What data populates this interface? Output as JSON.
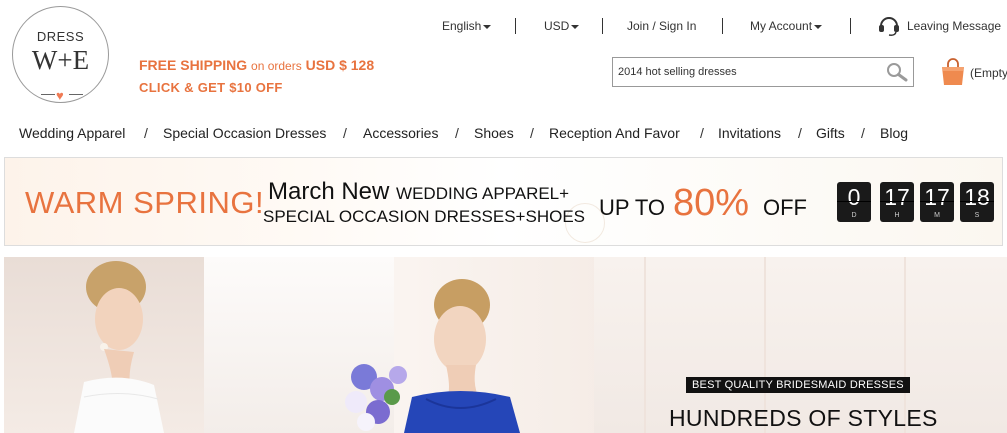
{
  "logo": {
    "line1": "DRESS",
    "line2": "W+E"
  },
  "promo": {
    "shipping_label": "FREE SHIPPING",
    "shipping_orders": "on orders",
    "shipping_amount": "USD $  128",
    "coupon": "CLICK & GET $10 OFF"
  },
  "topnav": {
    "language": "English",
    "currency": "USD",
    "join": "Join / Sign In",
    "account": "My Account",
    "message": "Leaving Message"
  },
  "search": {
    "value": "2014 hot selling dresses"
  },
  "cart": {
    "label": "(Empty"
  },
  "categories": [
    "Wedding Apparel",
    "Special Occasion Dresses",
    "Accessories",
    "Shoes",
    "Reception And Favor",
    "Invitations",
    "Gifts",
    "Blog"
  ],
  "banner": {
    "headline": "WARM SPRING!",
    "line1_a": "March New",
    "line1_b": "WEDDING APPAREL+",
    "line2": "SPECIAL OCCASION DRESSES+SHOES",
    "up_to": "UP TO",
    "percent": "80%",
    "off": "OFF",
    "countdown": [
      {
        "value": "0",
        "unit": "D"
      },
      {
        "value": "17",
        "unit": "H"
      },
      {
        "value": "17",
        "unit": "M"
      },
      {
        "value": "18",
        "unit": "S"
      }
    ]
  },
  "hero": {
    "tag": "BEST QUALITY BRIDESMAID DRESSES",
    "headline": "HUNDREDS OF STYLES"
  },
  "colors": {
    "accent": "#e8733f",
    "dark": "#111111",
    "countdown_bg": "#1a1a1a"
  }
}
